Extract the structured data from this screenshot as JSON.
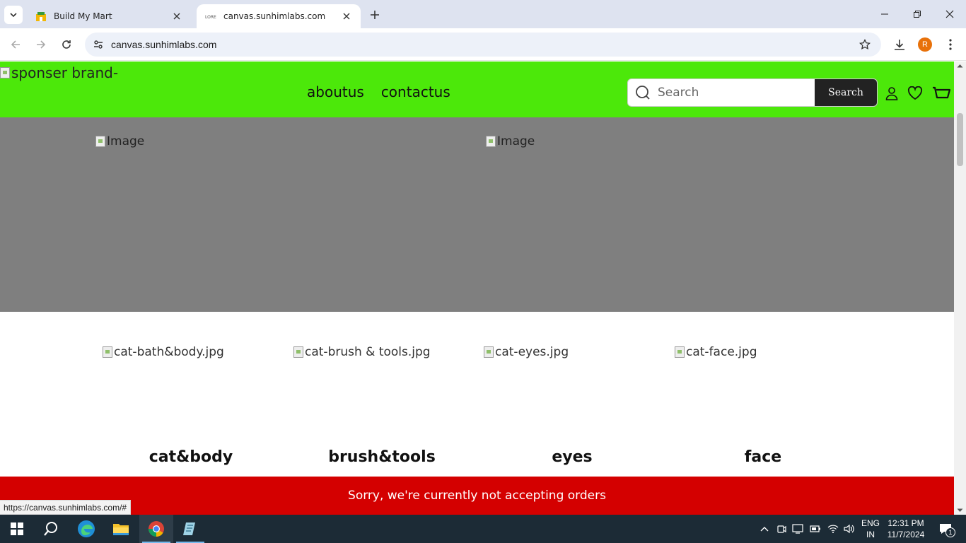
{
  "browser": {
    "tabs": [
      {
        "title": "Build My Mart"
      },
      {
        "title": "canvas.sunhimlabs.com"
      }
    ],
    "address": "canvas.sunhimlabs.com",
    "profile_initial": "R",
    "status_url": "https://canvas.sunhimlabs.com/#"
  },
  "site": {
    "brand_alt": "sponser brand-",
    "nav": [
      "aboutus",
      "contactus"
    ],
    "search": {
      "placeholder": "Search",
      "button": "Search"
    },
    "hero_images": [
      "Image",
      "Image"
    ],
    "categories": [
      {
        "image_alt": "cat-bath&body.jpg",
        "title": "cat&body"
      },
      {
        "image_alt": "cat-brush & tools.jpg",
        "title": "brush&tools"
      },
      {
        "image_alt": "cat-eyes.jpg",
        "title": "eyes"
      },
      {
        "image_alt": "cat-face.jpg",
        "title": "face"
      }
    ],
    "notice": "Sorry, we're currently not accepting orders",
    "colors": {
      "header": "#4ce80a",
      "hero": "#7f7f7f",
      "notice": "#d40000"
    }
  },
  "taskbar": {
    "lang_line1": "ENG",
    "lang_line2": "IN",
    "time": "12:31 PM",
    "date": "11/7/2024",
    "notification_count": "1"
  }
}
